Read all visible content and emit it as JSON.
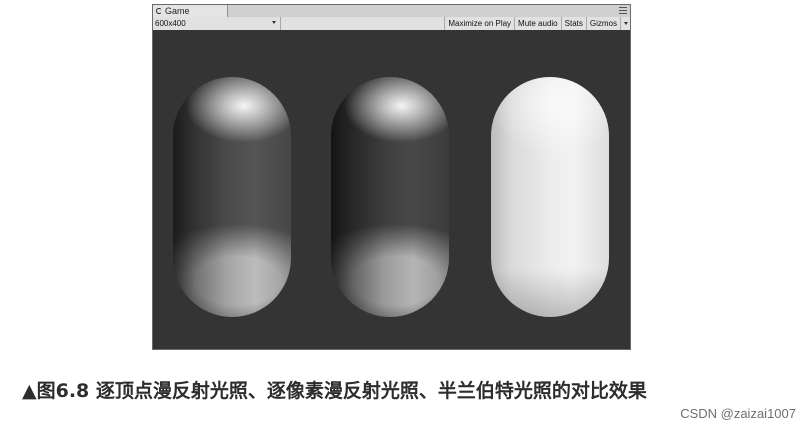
{
  "window": {
    "tab_title": "Game"
  },
  "toolbar": {
    "resolution": "600x400",
    "buttons": [
      "Maximize on Play",
      "Mute audio",
      "Stats",
      "Gizmos"
    ]
  },
  "caption": "▲图6.8 逐顶点漫反射光照、逐像素漫反射光照、半兰伯特光照的对比效果",
  "watermark": "CSDN @zaizai1007"
}
